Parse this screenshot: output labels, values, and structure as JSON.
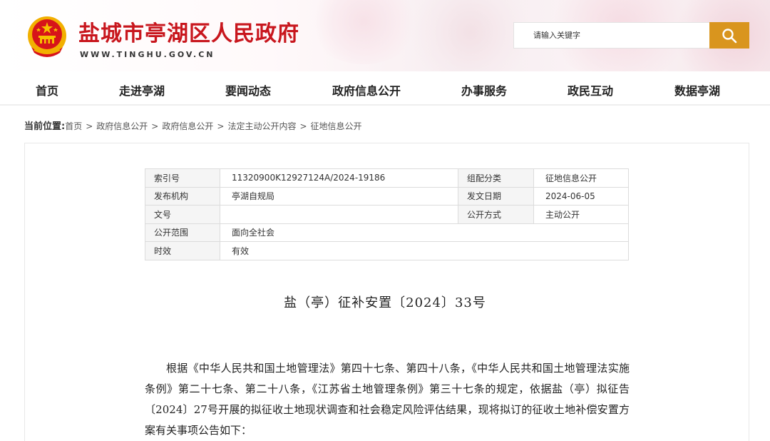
{
  "header": {
    "site_title": "盐城市亭湖区人民政府",
    "site_domain": "WWW.TINGHU.GOV.CN",
    "search_placeholder": "请输入关键字"
  },
  "nav": {
    "items": [
      {
        "label": "首页"
      },
      {
        "label": "走进亭湖"
      },
      {
        "label": "要闻动态"
      },
      {
        "label": "政府信息公开"
      },
      {
        "label": "办事服务"
      },
      {
        "label": "政民互动"
      },
      {
        "label": "数据亭湖"
      }
    ]
  },
  "breadcrumb": {
    "label": "当前位置:",
    "items": [
      "首页",
      "政府信息公开",
      "政府信息公开",
      "法定主动公开内容",
      "征地信息公开"
    ],
    "separator": ">"
  },
  "meta_table": {
    "rows": [
      {
        "label1": "索引号",
        "value1": "11320900K12927124A/2024-19186",
        "label2": "组配分类",
        "value2": "征地信息公开"
      },
      {
        "label1": "发布机构",
        "value1": "亭湖自规局",
        "label2": "发文日期",
        "value2": "2024-06-05"
      },
      {
        "label1": "文号",
        "value1": "",
        "label2": "公开方式",
        "value2": "主动公开"
      },
      {
        "label1": "公开范围",
        "value1": "面向全社会"
      },
      {
        "label1": "时效",
        "value1": "有效"
      }
    ]
  },
  "document": {
    "title": "盐（亭）征补安置〔2024〕33号",
    "body": "根据《中华人民共和国土地管理法》第四十七条、第四十八条，《中华人民共和国土地管理法实施条例》第二十七条、第二十八条，《江苏省土地管理条例》第三十七条的规定，依据盐（亭）拟征告〔2024〕27号开展的拟征收土地现状调查和社会稳定风险评估结果，现将拟订的征收土地补偿安置方案有关事项公告如下："
  },
  "colors": {
    "title_red": "#c8161d",
    "search_button": "#d9951e"
  },
  "icons": {
    "emblem": "national-emblem-icon",
    "search": "search-icon"
  }
}
